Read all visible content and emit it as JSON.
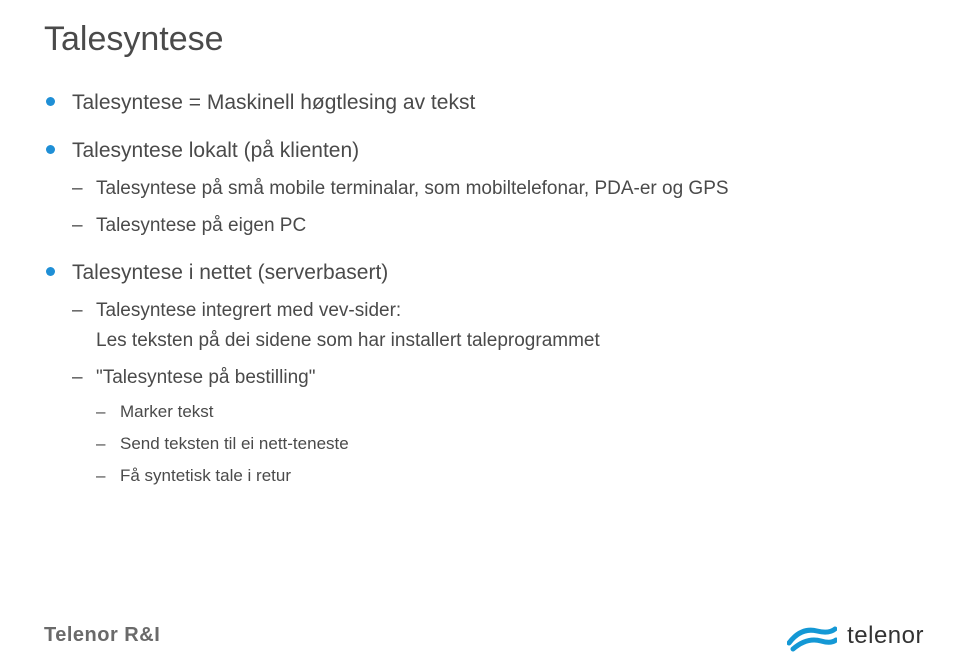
{
  "title": "Talesyntese",
  "bullets": {
    "b1": "Talesyntese = Maskinell høgtlesing av tekst",
    "b2": "Talesyntese lokalt (på klienten)",
    "b2_1": "Talesyntese på små mobile terminalar, som mobiltelefonar, PDA-er og GPS",
    "b2_2": "Talesyntese på eigen PC",
    "b3": "Talesyntese i nettet (serverbasert)",
    "b3_1a": "Talesyntese integrert med vev-sider:",
    "b3_1b": "Les teksten på dei sidene som har installert taleprogrammet",
    "b3_2": "\"Talesyntese på bestilling\"",
    "b3_2_1": "Marker tekst",
    "b3_2_2": "Send teksten til ei nett-teneste",
    "b3_2_3": "Få syntetisk tale i retur"
  },
  "footer": {
    "left": "Telenor R&I",
    "right": "telenor"
  }
}
